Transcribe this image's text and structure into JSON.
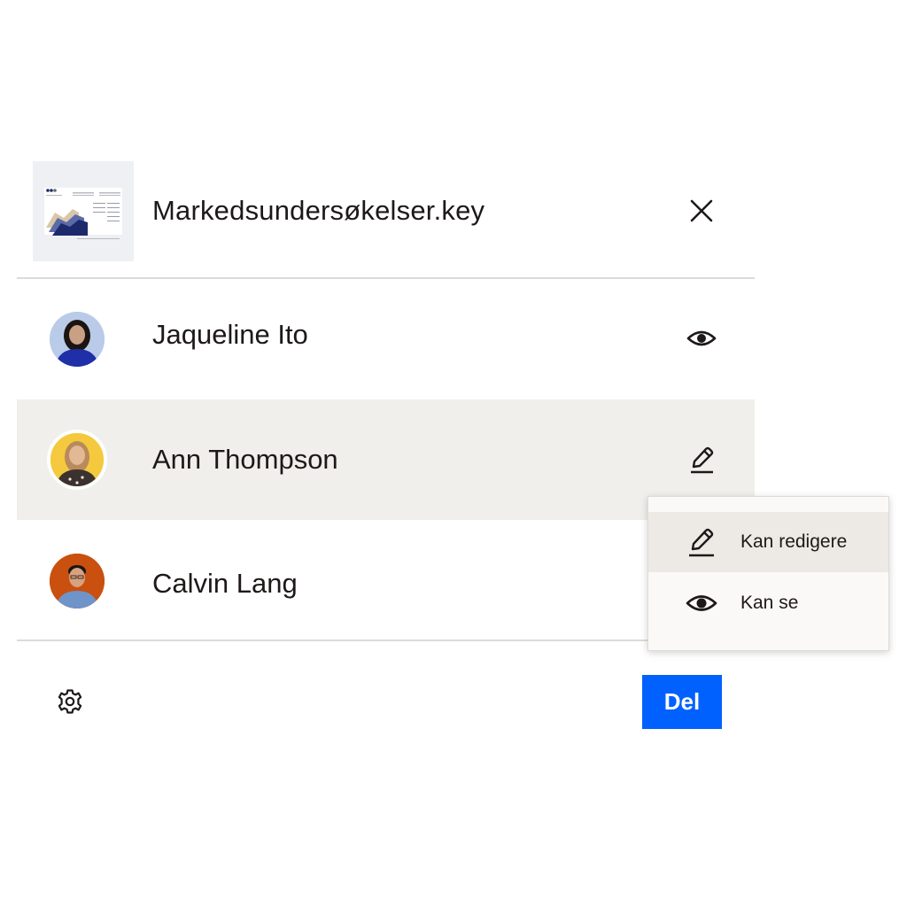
{
  "file": {
    "name": "Markedsundersøkelser.key",
    "thumbnail_icon": "keynote-slide-thumbnail",
    "close_icon": "close-icon"
  },
  "people": [
    {
      "name": "Jaqueline Ito",
      "permission_icon": "eye-icon",
      "avatar_color": "#b9cbe8",
      "selected": false
    },
    {
      "name": "Ann Thompson",
      "permission_icon": "pencil-icon",
      "avatar_color": "#f5c93d",
      "selected": true
    },
    {
      "name": "Calvin Lang",
      "permission_icon": "",
      "avatar_color": "#c9500f",
      "selected": false
    }
  ],
  "permission_menu": {
    "items": [
      {
        "label": "Kan redigere",
        "icon": "pencil-icon",
        "active": true
      },
      {
        "label": "Kan se",
        "icon": "eye-icon",
        "active": false
      }
    ]
  },
  "footer": {
    "settings_icon": "gear-icon",
    "share_label": "Del"
  },
  "colors": {
    "accent": "#0061fe",
    "selected_row": "#f1efeb",
    "text": "#1e1919"
  }
}
